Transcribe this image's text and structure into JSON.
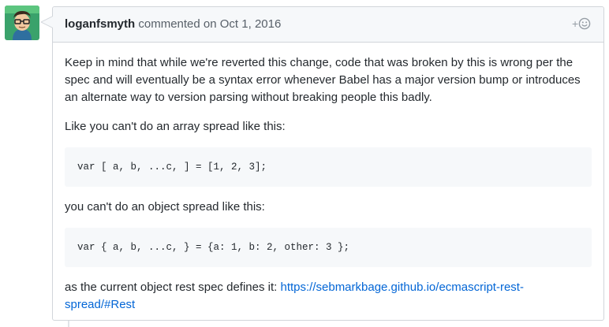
{
  "comment": {
    "author": "loganfsmyth",
    "action": "commented on",
    "date": "Oct 1, 2016",
    "paragraph1": "Keep in mind that while we're reverted this change, code that was broken by this is wrong per the spec and will eventually be a syntax error whenever Babel has a major version bump or introduces an alternate way to version parsing without breaking people this badly.",
    "paragraph2": "Like you can't do an array spread like this:",
    "code1": "var [ a, b, ...c, ] = [1, 2, 3];",
    "paragraph3": "you can't do an object spread like this:",
    "code2": "var { a, b, ...c, } = {a: 1, b: 2, other: 3 };",
    "paragraph4_prefix": "as the current object rest spec defines it: ",
    "link_text": "https://sebmarkbage.github.io/ecmascript-rest-spread/#Rest"
  },
  "icons": {
    "avatar": "user-avatar",
    "reaction": "add-reaction-icon"
  },
  "colors": {
    "link": "#0366d6",
    "header_bg": "#f6f8fa",
    "border": "#d1d5da",
    "code_bg": "#f6f8fa"
  }
}
